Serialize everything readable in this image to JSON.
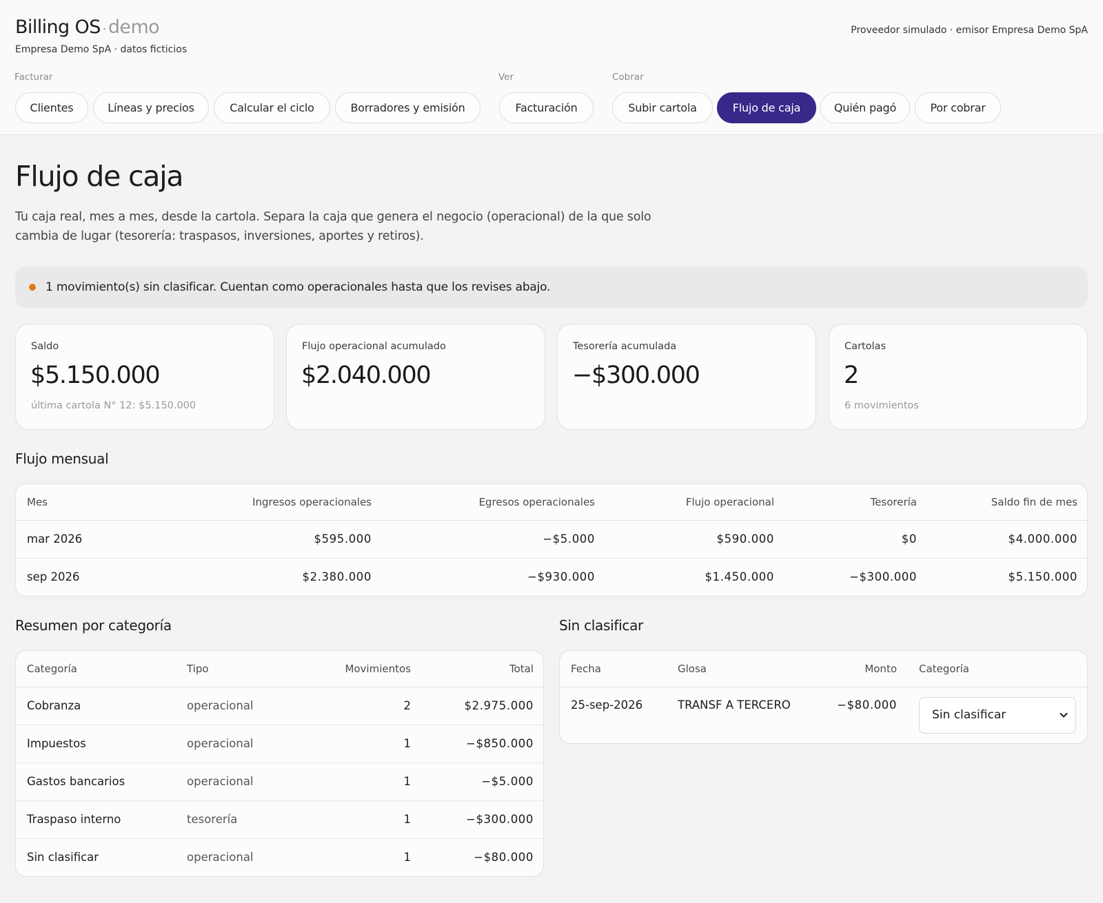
{
  "header": {
    "brand": "Billing OS",
    "env": "demo",
    "company": "Empresa Demo SpA · datos ficticios",
    "provider": "Proveedor simulado · emisor Empresa Demo SpA"
  },
  "nav": {
    "groups": {
      "facturar": "Facturar",
      "ver": "Ver",
      "cobrar": "Cobrar"
    },
    "items": {
      "clientes": "Clientes",
      "lineas": "Líneas y precios",
      "ciclo": "Calcular el ciclo",
      "borradores": "Borradores y emisión",
      "facturacion": "Facturación",
      "subir": "Subir cartola",
      "flujo": "Flujo de caja",
      "quien": "Quién pagó",
      "porcobrar": "Por cobrar"
    },
    "active": "Flujo de caja",
    "active_color": "#36298a"
  },
  "page": {
    "title": "Flujo de caja",
    "description": "Tu caja real, mes a mes, desde la cartola. Separa la caja que genera el negocio (operacional) de la que solo cambia de lugar (tesorería: traspasos, inversiones, aportes y retiros)."
  },
  "alert": {
    "text": "1 movimiento(s) sin clasificar. Cuentan como operacionales hasta que los revises abajo.",
    "dot_color": "#de7a10"
  },
  "cards": {
    "saldo": {
      "label": "Saldo",
      "value": "$5.150.000",
      "sub": "última cartola N° 12: $5.150.000"
    },
    "flujo": {
      "label": "Flujo operacional acumulado",
      "value": "$2.040.000"
    },
    "tesoreria": {
      "label": "Tesorería acumulada",
      "value": "−$300.000"
    },
    "cartolas": {
      "label": "Cartolas",
      "value": "2",
      "sub": "6 movimientos"
    }
  },
  "monthly": {
    "title": "Flujo mensual",
    "headers": [
      "Mes",
      "Ingresos operacionales",
      "Egresos operacionales",
      "Flujo operacional",
      "Tesorería",
      "Saldo fin de mes"
    ],
    "rows": [
      [
        "mar 2026",
        "$595.000",
        "−$5.000",
        "$590.000",
        "$0",
        "$4.000.000"
      ],
      [
        "sep 2026",
        "$2.380.000",
        "−$930.000",
        "$1.450.000",
        "−$300.000",
        "$5.150.000"
      ]
    ]
  },
  "summary": {
    "title": "Resumen por categoría",
    "headers": [
      "Categoría",
      "Tipo",
      "Movimientos",
      "Total"
    ],
    "rows": [
      [
        "Cobranza",
        "operacional",
        "2",
        "$2.975.000"
      ],
      [
        "Impuestos",
        "operacional",
        "1",
        "−$850.000"
      ],
      [
        "Gastos bancarios",
        "operacional",
        "1",
        "−$5.000"
      ],
      [
        "Traspaso interno",
        "tesorería",
        "1",
        "−$300.000"
      ],
      [
        "Sin clasificar",
        "operacional",
        "1",
        "−$80.000"
      ]
    ]
  },
  "unclassified": {
    "title": "Sin clasificar",
    "headers": [
      "Fecha",
      "Glosa",
      "Monto",
      "Categoría"
    ],
    "rows": [
      {
        "fecha": "25-sep-2026",
        "glosa": "TRANSF A TERCERO",
        "monto": "−$80.000",
        "categoria": "Sin clasificar"
      }
    ],
    "select_icon": "chevron-down-icon"
  }
}
